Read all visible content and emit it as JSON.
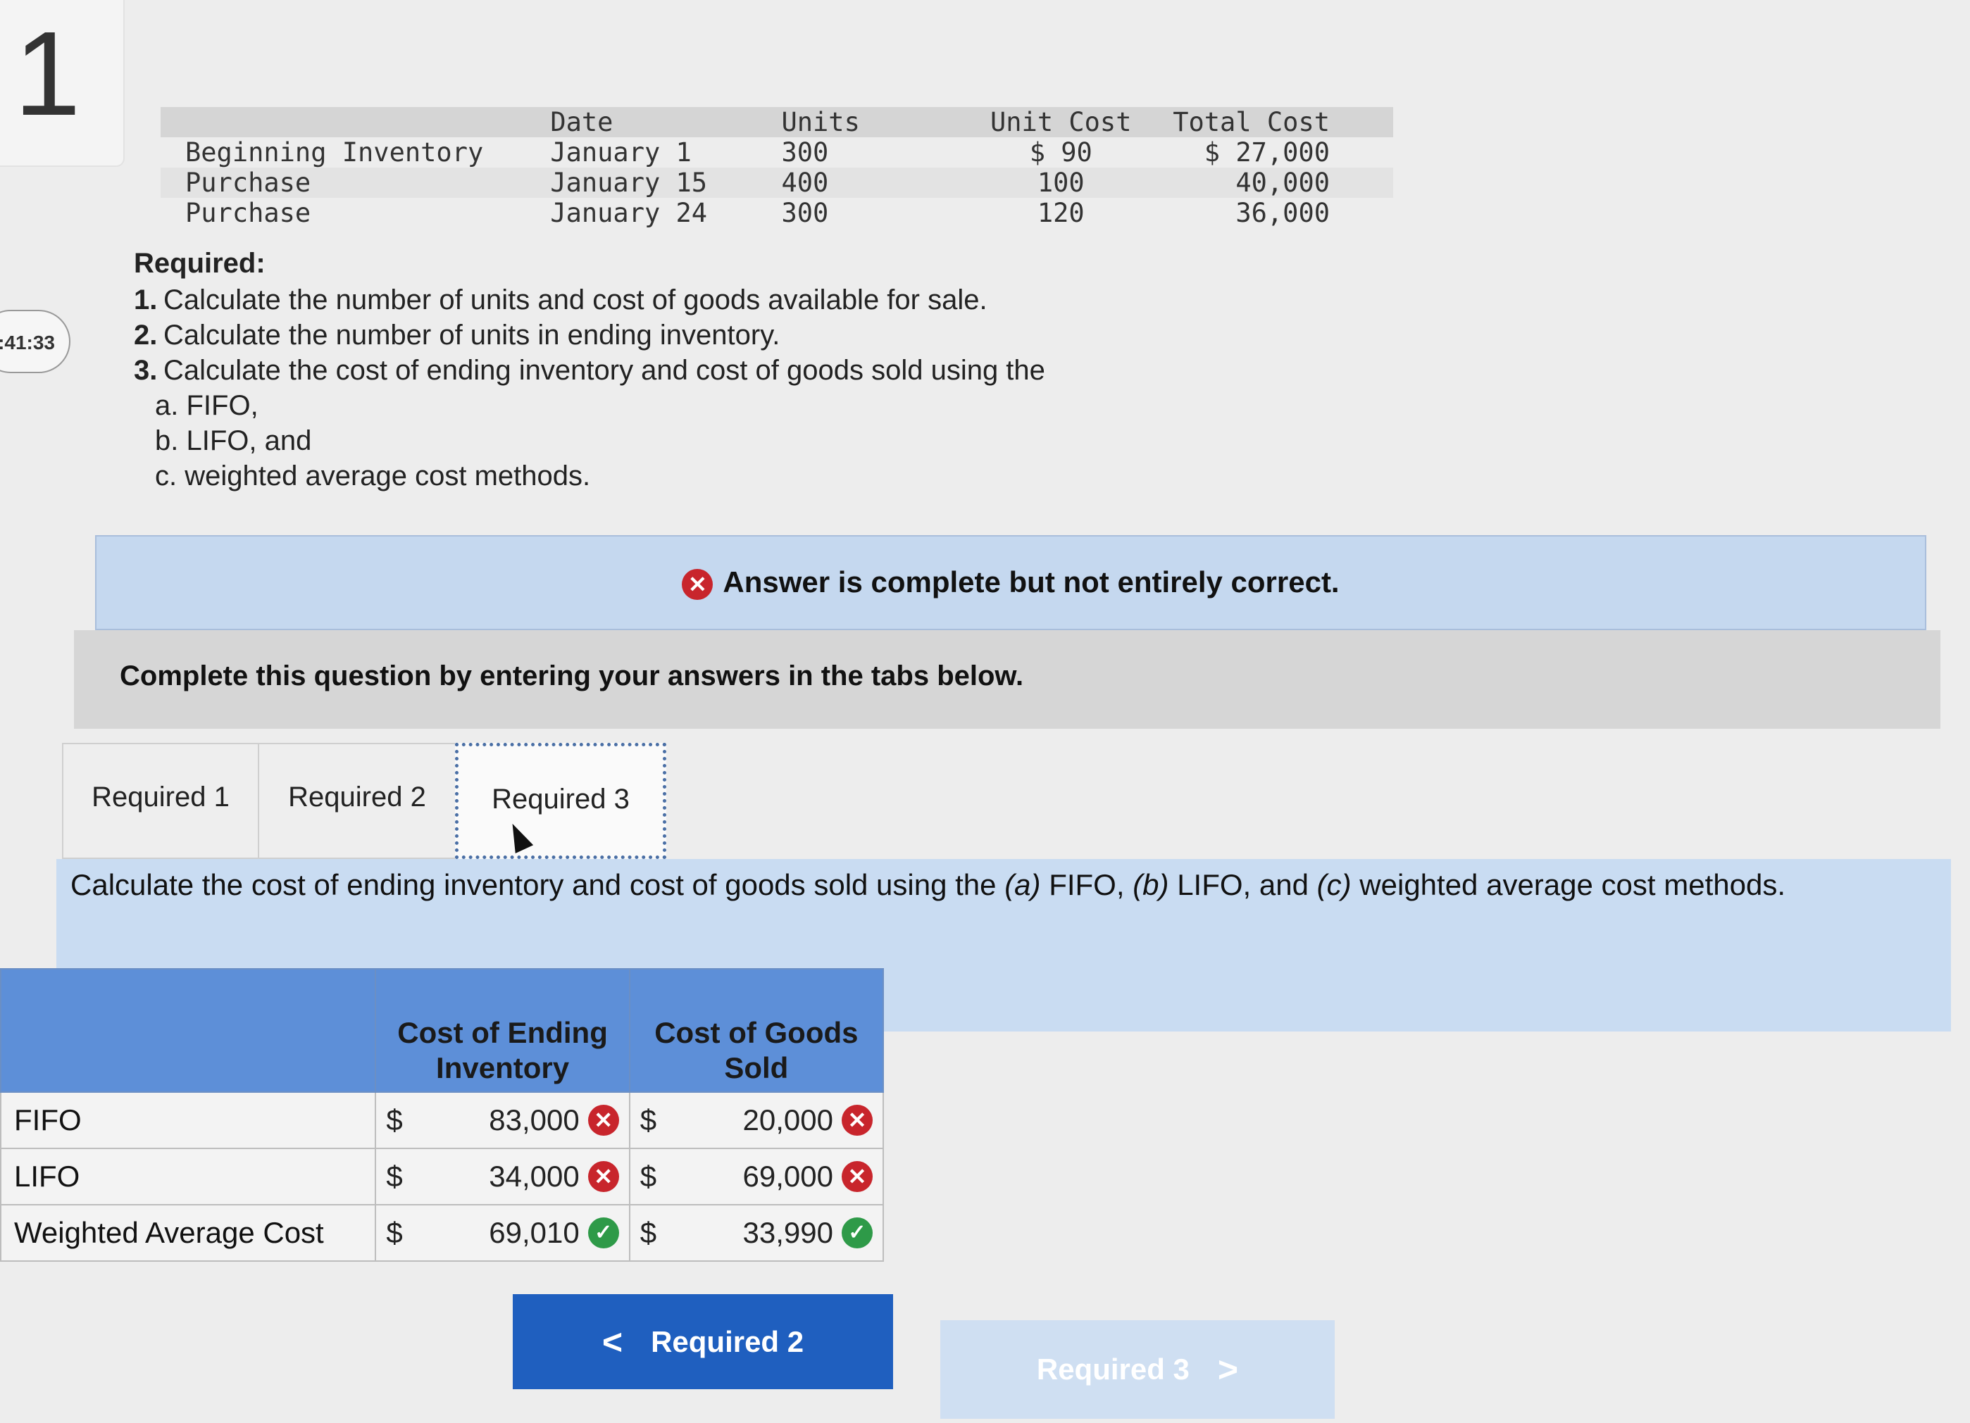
{
  "question": {
    "number": "1",
    "timer": ":41:33"
  },
  "inventory_table": {
    "headers": [
      "",
      "Date",
      "Units",
      "Unit Cost",
      "Total Cost"
    ],
    "rows": [
      {
        "label": "Beginning Inventory",
        "date": "January 1",
        "units": "300",
        "unit_cost": "$ 90",
        "total_cost": "$ 27,000"
      },
      {
        "label": "Purchase",
        "date": "January 15",
        "units": "400",
        "unit_cost": "100",
        "total_cost": "40,000"
      },
      {
        "label": "Purchase",
        "date": "January 24",
        "units": "300",
        "unit_cost": "120",
        "total_cost": "36,000"
      }
    ]
  },
  "required": {
    "title": "Required:",
    "items": [
      {
        "num": "1.",
        "text": "Calculate the number of units and cost of goods available for sale."
      },
      {
        "num": "2.",
        "text": "Calculate the number of units in ending inventory."
      },
      {
        "num": "3.",
        "text": "Calculate the cost of ending inventory and cost of goods sold using the"
      }
    ],
    "subitems": [
      "a. FIFO,",
      "b. LIFO, and",
      "c. weighted average cost methods."
    ]
  },
  "banner": {
    "text": "Answer is complete but not entirely correct."
  },
  "complete_text": "Complete this question by entering your answers in the tabs below.",
  "tabs": [
    {
      "label": "Required 1"
    },
    {
      "label": "Required 2"
    },
    {
      "label": "Required 3"
    }
  ],
  "instruction": {
    "part1": "Calculate the cost of ending inventory and cost of goods sold using the ",
    "a": "(a)",
    "fifo": " FIFO, ",
    "b": "(b)",
    "lifo": " LIFO, and ",
    "c": "(c)",
    "rest": " weighted average cost methods."
  },
  "cost_table": {
    "headers": {
      "blank": "",
      "ending": "Cost of Ending Inventory",
      "cogs": "Cost of Goods Sold"
    },
    "currency": "$",
    "rows": [
      {
        "label": "FIFO",
        "ending": "83,000",
        "ending_status": "incorrect",
        "cogs": "20,000",
        "cogs_status": "incorrect"
      },
      {
        "label": "LIFO",
        "ending": "34,000",
        "ending_status": "incorrect",
        "cogs": "69,000",
        "cogs_status": "incorrect"
      },
      {
        "label": "Weighted Average Cost",
        "ending": "69,010",
        "ending_status": "correct",
        "cogs": "33,990",
        "cogs_status": "correct"
      }
    ]
  },
  "nav": {
    "prev_label": "Required 2",
    "next_label": "Required 3"
  },
  "colors": {
    "header_blue": "#5d8fd8",
    "banner_blue": "#c5d8ef",
    "error_red": "#c8252c",
    "ok_green": "#2e9a48",
    "button_blue": "#1f5fbf"
  }
}
